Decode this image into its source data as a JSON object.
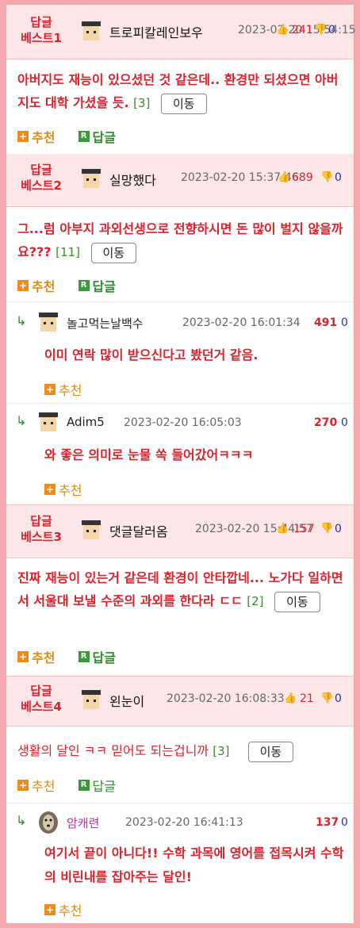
{
  "comments": [
    {
      "best": "답글\n베스트1",
      "best_line1": "답글",
      "best_line2": "베스트1",
      "nick": "트로피칼레인보우",
      "date": "2023-02-20 15:54:15",
      "up": "241",
      "down": "0",
      "text": "아버지도 재능이 있으셨던 것 같은데.. 환경만 되셨으면 아버지도 대학 가셨을 듯.",
      "count": "[3]",
      "move": "이동",
      "rec": "추천",
      "reply": "답글"
    },
    {
      "best_line1": "답글",
      "best_line2": "베스트2",
      "nick": "실망했다",
      "date": "2023-02-20 15:37:46",
      "up": "689",
      "down": "0",
      "text": "그...럼 아부지 과외선생으로 전향하시면 돈 많이 벌지 않을까요???",
      "count": "[11]",
      "move": "이동",
      "rec": "추천",
      "reply": "답글",
      "replies": [
        {
          "nick": "놀고먹는날백수",
          "date": "2023-02-20 16:01:34",
          "up": "491",
          "down": "0",
          "text": "이미 연락 많이 받으신다고 봤던거 같음.",
          "rec": "추천"
        },
        {
          "nick": "Adim5",
          "date": "2023-02-20 16:05:03",
          "up": "270",
          "down": "0",
          "text": "와 좋은 의미로 눈물 쏙 들어갔어ㅋㅋㅋ",
          "rec": "추천"
        }
      ]
    },
    {
      "best_line1": "답글",
      "best_line2": "베스트3",
      "nick": "댓글달러옴",
      "date": "2023-02-20 15:44:57",
      "up": "157",
      "down": "0",
      "text": "진짜 재능이 있는거 같은데 환경이 안타깝네... 노가다 일하면서 서울대 보낼 수준의 과외를 한다라 ㄷㄷ",
      "count": "[2]",
      "move": "이동",
      "rec": "추천",
      "reply": "답글"
    },
    {
      "best_line1": "답글",
      "best_line2": "베스트4",
      "nick": "왼눈이",
      "date": "2023-02-20 16:08:33",
      "up": "21",
      "down": "0",
      "text": "생활의 달인 ㅋㅋ 믿어도 되는겁니까",
      "count": "[3]",
      "move": "이동",
      "rec": "추천",
      "reply": "답글",
      "replies": [
        {
          "nick": "암캐련",
          "date": "2023-02-20 16:41:13",
          "up": "137",
          "down": "0",
          "text": "여기서 끝이 아니다!! 수학 과목에 영어를 접목시켜 수학의 비린내를 잡아주는 달인!",
          "rec": "추천"
        }
      ]
    }
  ],
  "icons": {
    "thumb_up": "thumbs-up-icon",
    "thumb_down": "thumbs-down-icon",
    "reply_arrow": "reply-arrow-icon",
    "recommend": "plus-icon",
    "reply_badge": "r-badge-icon"
  },
  "colors": {
    "accent": "#e0202a",
    "frame": "#f4a8ad",
    "header_bg": "#fde6e8",
    "recommend": "#f08a1a",
    "reply": "#3a9a3a",
    "down": "#2030c0"
  }
}
